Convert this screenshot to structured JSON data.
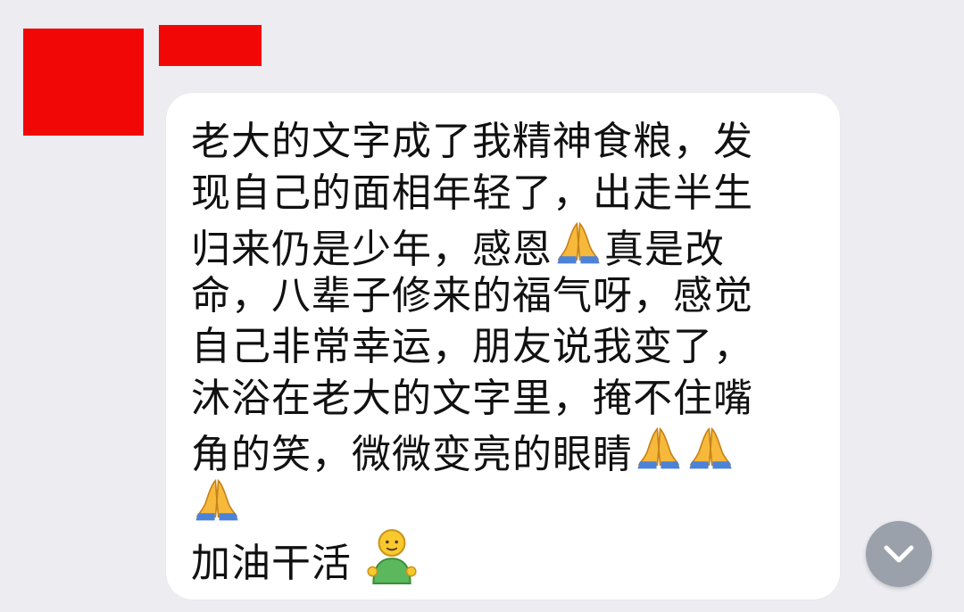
{
  "message": {
    "lines": [
      "老大的文字成了我精神食粮，发",
      "现自己的面相年轻了，出走半生",
      "归来仍是少年，感恩",
      "真是改",
      "命，八辈子修来的福气呀，感觉",
      "自己非常幸运，朋友说我变了，",
      "沐浴在老大的文字里，掩不住嘴",
      "角的笑，微微变亮的眼睛",
      "加油干活"
    ],
    "icons": {
      "pray": "folded-hands-icon",
      "person": "person-icon",
      "scroll": "chevron-down-icon"
    },
    "colors": {
      "redaction": "#f20707",
      "bubble": "#ffffff",
      "background": "#ececf1",
      "scroll_button": "#9aa1ab"
    }
  }
}
